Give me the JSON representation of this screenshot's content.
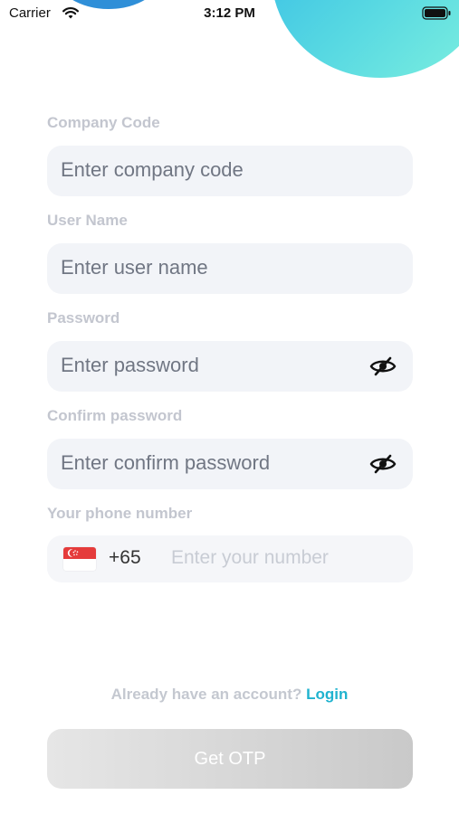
{
  "status_bar": {
    "carrier": "Carrier",
    "time": "3:12 PM"
  },
  "form": {
    "company_code": {
      "label": "Company Code",
      "placeholder": "Enter company code"
    },
    "user_name": {
      "label": "User Name",
      "placeholder": "Enter user name"
    },
    "password": {
      "label": "Password",
      "placeholder": "Enter password"
    },
    "confirm_password": {
      "label": "Confirm password",
      "placeholder": "Enter confirm password"
    },
    "phone": {
      "label": "Your phone number",
      "dial_code": "+65",
      "placeholder": "Enter your number"
    }
  },
  "footer": {
    "prompt": "Already have an account?",
    "login_link": "Login",
    "otp_button": "Get OTP"
  },
  "colors": {
    "accent": "#20b3cf",
    "field_bg": "#f2f4f8",
    "label": "#c3c6cf"
  },
  "icons": [
    "wifi-icon",
    "battery-icon",
    "eye-slash-icon",
    "singapore-flag-icon"
  ]
}
